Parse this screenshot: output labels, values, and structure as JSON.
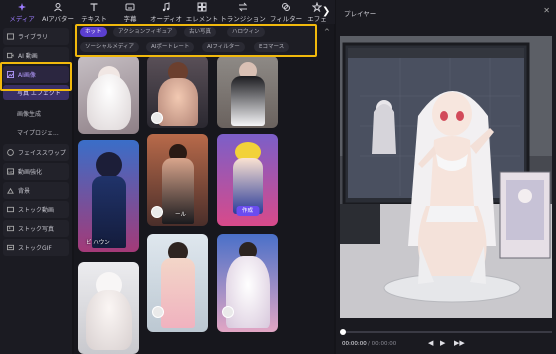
{
  "toolbar": {
    "items": [
      {
        "label": "メディア",
        "icon": "media-icon",
        "active": true
      },
      {
        "label": "AIアバター",
        "icon": "ai-avatar-icon",
        "active": false
      },
      {
        "label": "テキスト",
        "icon": "text-icon",
        "active": false
      },
      {
        "label": "字幕",
        "icon": "subtitle-icon",
        "active": false
      },
      {
        "label": "オーディオ",
        "icon": "audio-icon",
        "active": false
      },
      {
        "label": "エレメント",
        "icon": "element-icon",
        "active": false
      },
      {
        "label": "トランジション",
        "icon": "transition-icon",
        "active": false
      },
      {
        "label": "フィルター",
        "icon": "filter-icon",
        "active": false
      },
      {
        "label": "エフェ",
        "icon": "effect-icon",
        "active": false
      }
    ]
  },
  "sidebar": {
    "items": [
      {
        "label": "ライブラリ",
        "icon": "library-icon",
        "selected": false
      },
      {
        "label": "AI 動画",
        "icon": "ai-video-icon",
        "selected": false
      },
      {
        "label": "AI画像",
        "icon": "ai-image-icon",
        "selected": true
      },
      {
        "label": "写真 エフェクト",
        "sub": true,
        "selected": true
      },
      {
        "label": "画像生成",
        "sub": true,
        "selected": false
      },
      {
        "label": "マイプロジェ...",
        "sub": true,
        "selected": false
      },
      {
        "label": "フェイススワップ",
        "icon": "face-swap-icon",
        "selected": false
      },
      {
        "label": "動画強化",
        "icon": "enhance-icon",
        "selected": false
      },
      {
        "label": "背景",
        "icon": "background-icon",
        "selected": false
      },
      {
        "label": "ストック動画",
        "icon": "stock-video-icon",
        "selected": false
      },
      {
        "label": "ストック写真",
        "icon": "stock-photo-icon",
        "selected": false
      },
      {
        "label": "ストックGIF",
        "icon": "stock-gif-icon",
        "selected": false
      }
    ]
  },
  "chips": {
    "row1": [
      "ホット",
      "アクションフィギュア",
      "古い写真",
      "ハロウィン"
    ],
    "row2": [
      "ソーシャルメディア",
      "AIポートレート",
      "AIフィルター",
      "Eコマース"
    ],
    "selected": "ホット"
  },
  "gallery": {
    "cards": [
      {
        "id": "c1",
        "badge": ""
      },
      {
        "id": "c2",
        "badge": ""
      },
      {
        "id": "c3",
        "badge": ""
      },
      {
        "id": "c4",
        "badge": ""
      },
      {
        "id": "c5",
        "badge": "",
        "caption": "ール"
      },
      {
        "id": "c6",
        "badge": "作成"
      },
      {
        "id": "c7",
        "badge": "",
        "caption": "ビ ハウン"
      },
      {
        "id": "c8",
        "badge": ""
      },
      {
        "id": "c9",
        "badge": ""
      },
      {
        "id": "c10",
        "badge": ""
      }
    ],
    "scroll_up": "^"
  },
  "player": {
    "title": "プレイヤー",
    "current_time": "00:00:00",
    "total_time": "/ 00:00:00",
    "controls": [
      "◀",
      "▶",
      "▶▶"
    ]
  }
}
